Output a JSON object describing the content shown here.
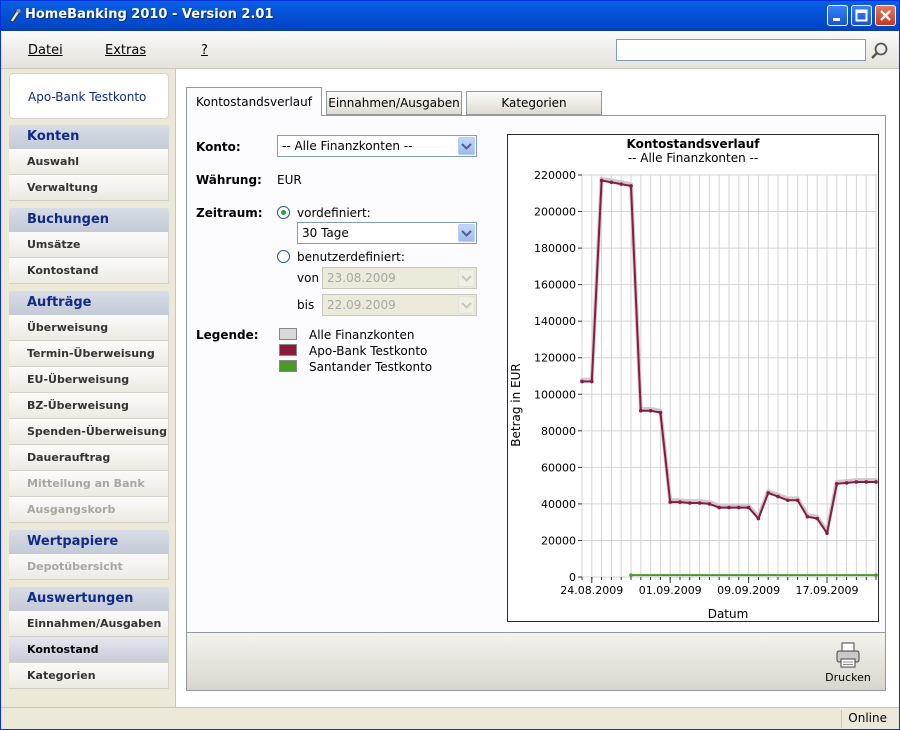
{
  "window": {
    "title": "HomeBanking 2010 - Version 2.01"
  },
  "menu": {
    "items": [
      "Datei",
      "Extras",
      "?"
    ],
    "search_value": ""
  },
  "sidebar": {
    "account": "Apo-Bank Testkonto",
    "sections": [
      {
        "title": "Konten",
        "items": [
          {
            "label": "Auswahl",
            "state": "normal"
          },
          {
            "label": "Verwaltung",
            "state": "normal"
          }
        ]
      },
      {
        "title": "Buchungen",
        "items": [
          {
            "label": "Umsätze",
            "state": "normal"
          },
          {
            "label": "Kontostand",
            "state": "normal"
          }
        ]
      },
      {
        "title": "Aufträge",
        "items": [
          {
            "label": "Überweisung",
            "state": "normal"
          },
          {
            "label": "Termin-Überweisung",
            "state": "normal"
          },
          {
            "label": "EU-Überweisung",
            "state": "normal"
          },
          {
            "label": "BZ-Überweisung",
            "state": "normal"
          },
          {
            "label": "Spenden-Überweisung",
            "state": "normal"
          },
          {
            "label": "Dauerauftrag",
            "state": "normal"
          },
          {
            "label": "Mitteilung an Bank",
            "state": "disabled"
          },
          {
            "label": "Ausgangskorb",
            "state": "disabled"
          }
        ]
      },
      {
        "title": "Wertpapiere",
        "items": [
          {
            "label": "Depotübersicht",
            "state": "disabled"
          }
        ]
      },
      {
        "title": "Auswertungen",
        "items": [
          {
            "label": "Einnahmen/Ausgaben",
            "state": "normal"
          },
          {
            "label": "Kontostand",
            "state": "active"
          },
          {
            "label": "Kategorien",
            "state": "normal"
          }
        ]
      }
    ]
  },
  "tabs": [
    {
      "label": "Kontostandsverlauf",
      "active": true
    },
    {
      "label": "Einnahmen/Ausgaben",
      "active": false
    },
    {
      "label": "Kategorien",
      "active": false
    }
  ],
  "form": {
    "konto_label": "Konto:",
    "konto_value": "-- Alle Finanzkonten --",
    "waehrung_label": "Währung:",
    "waehrung_value": "EUR",
    "zeitraum_label": "Zeitraum:",
    "radio_predefined": "vordefiniert:",
    "predefined_value": "30 Tage",
    "radio_custom": "benutzerdefiniert:",
    "von_label": "von",
    "von_value": "23.08.2009",
    "bis_label": "bis",
    "bis_value": "22.09.2009",
    "legend_label": "Legende:",
    "legend": [
      {
        "label": "Alle Finanzkonten",
        "color": "#d9d9d9"
      },
      {
        "label": "Apo-Bank Testkonto",
        "color": "#8b1a3c"
      },
      {
        "label": "Santander Testkonto",
        "color": "#4a9a2b"
      }
    ]
  },
  "chart_data": {
    "type": "line",
    "title": "Kontostandsverlauf",
    "subtitle": "-- Alle Finanzkonten --",
    "xlabel": "Datum",
    "ylabel": "Betrag in EUR",
    "ylim": [
      0,
      220000
    ],
    "x_range": [
      "23.08.2009",
      "22.09.2009"
    ],
    "yticks": [
      0,
      20000,
      40000,
      60000,
      80000,
      100000,
      120000,
      140000,
      160000,
      180000,
      200000,
      220000
    ],
    "xticks": [
      "24.08.2009",
      "01.09.2009",
      "09.09.2009",
      "17.09.2009"
    ],
    "grid": true,
    "series": [
      {
        "name": "Alle Finanzkonten",
        "color": "#d0c9cf",
        "x": [
          "23.08.2009",
          "24.08.2009",
          "25.08.2009",
          "26.08.2009",
          "27.08.2009",
          "28.08.2009",
          "29.08.2009",
          "30.08.2009",
          "31.08.2009",
          "01.09.2009",
          "02.09.2009",
          "03.09.2009",
          "04.09.2009",
          "05.09.2009",
          "06.09.2009",
          "07.09.2009",
          "08.09.2009",
          "09.09.2009",
          "10.09.2009",
          "11.09.2009",
          "12.09.2009",
          "13.09.2009",
          "14.09.2009",
          "15.09.2009",
          "16.09.2009",
          "17.09.2009",
          "18.09.2009",
          "19.09.2009",
          "20.09.2009",
          "21.09.2009",
          "22.09.2009"
        ],
        "values": [
          108000,
          108000,
          218000,
          217000,
          216000,
          215000,
          92000,
          92000,
          91000,
          42000,
          42000,
          41500,
          41500,
          41000,
          39000,
          39000,
          39000,
          39000,
          33000,
          47000,
          45000,
          43000,
          43000,
          34000,
          33000,
          25000,
          52000,
          52500,
          53000,
          53000,
          53000
        ]
      },
      {
        "name": "Apo-Bank Testkonto",
        "color": "#8b1a3c",
        "x": [
          "23.08.2009",
          "24.08.2009",
          "25.08.2009",
          "26.08.2009",
          "27.08.2009",
          "28.08.2009",
          "29.08.2009",
          "30.08.2009",
          "31.08.2009",
          "01.09.2009",
          "02.09.2009",
          "03.09.2009",
          "04.09.2009",
          "05.09.2009",
          "06.09.2009",
          "07.09.2009",
          "08.09.2009",
          "09.09.2009",
          "10.09.2009",
          "11.09.2009",
          "12.09.2009",
          "13.09.2009",
          "14.09.2009",
          "15.09.2009",
          "16.09.2009",
          "17.09.2009",
          "18.09.2009",
          "19.09.2009",
          "20.09.2009",
          "21.09.2009",
          "22.09.2009"
        ],
        "values": [
          107000,
          107000,
          217000,
          216000,
          215000,
          214000,
          91000,
          91000,
          90000,
          41000,
          41000,
          40500,
          40500,
          40000,
          38000,
          38000,
          38000,
          38000,
          32000,
          46000,
          44000,
          42000,
          42000,
          33000,
          32000,
          24000,
          51000,
          51500,
          52000,
          52000,
          52000
        ]
      },
      {
        "name": "Santander Testkonto",
        "color": "#4a9a2b",
        "x": [
          "28.08.2009",
          "22.09.2009"
        ],
        "values": [
          1000,
          1000
        ]
      }
    ]
  },
  "footer": {
    "print_label": "Drucken"
  },
  "status": {
    "text": "Online"
  }
}
